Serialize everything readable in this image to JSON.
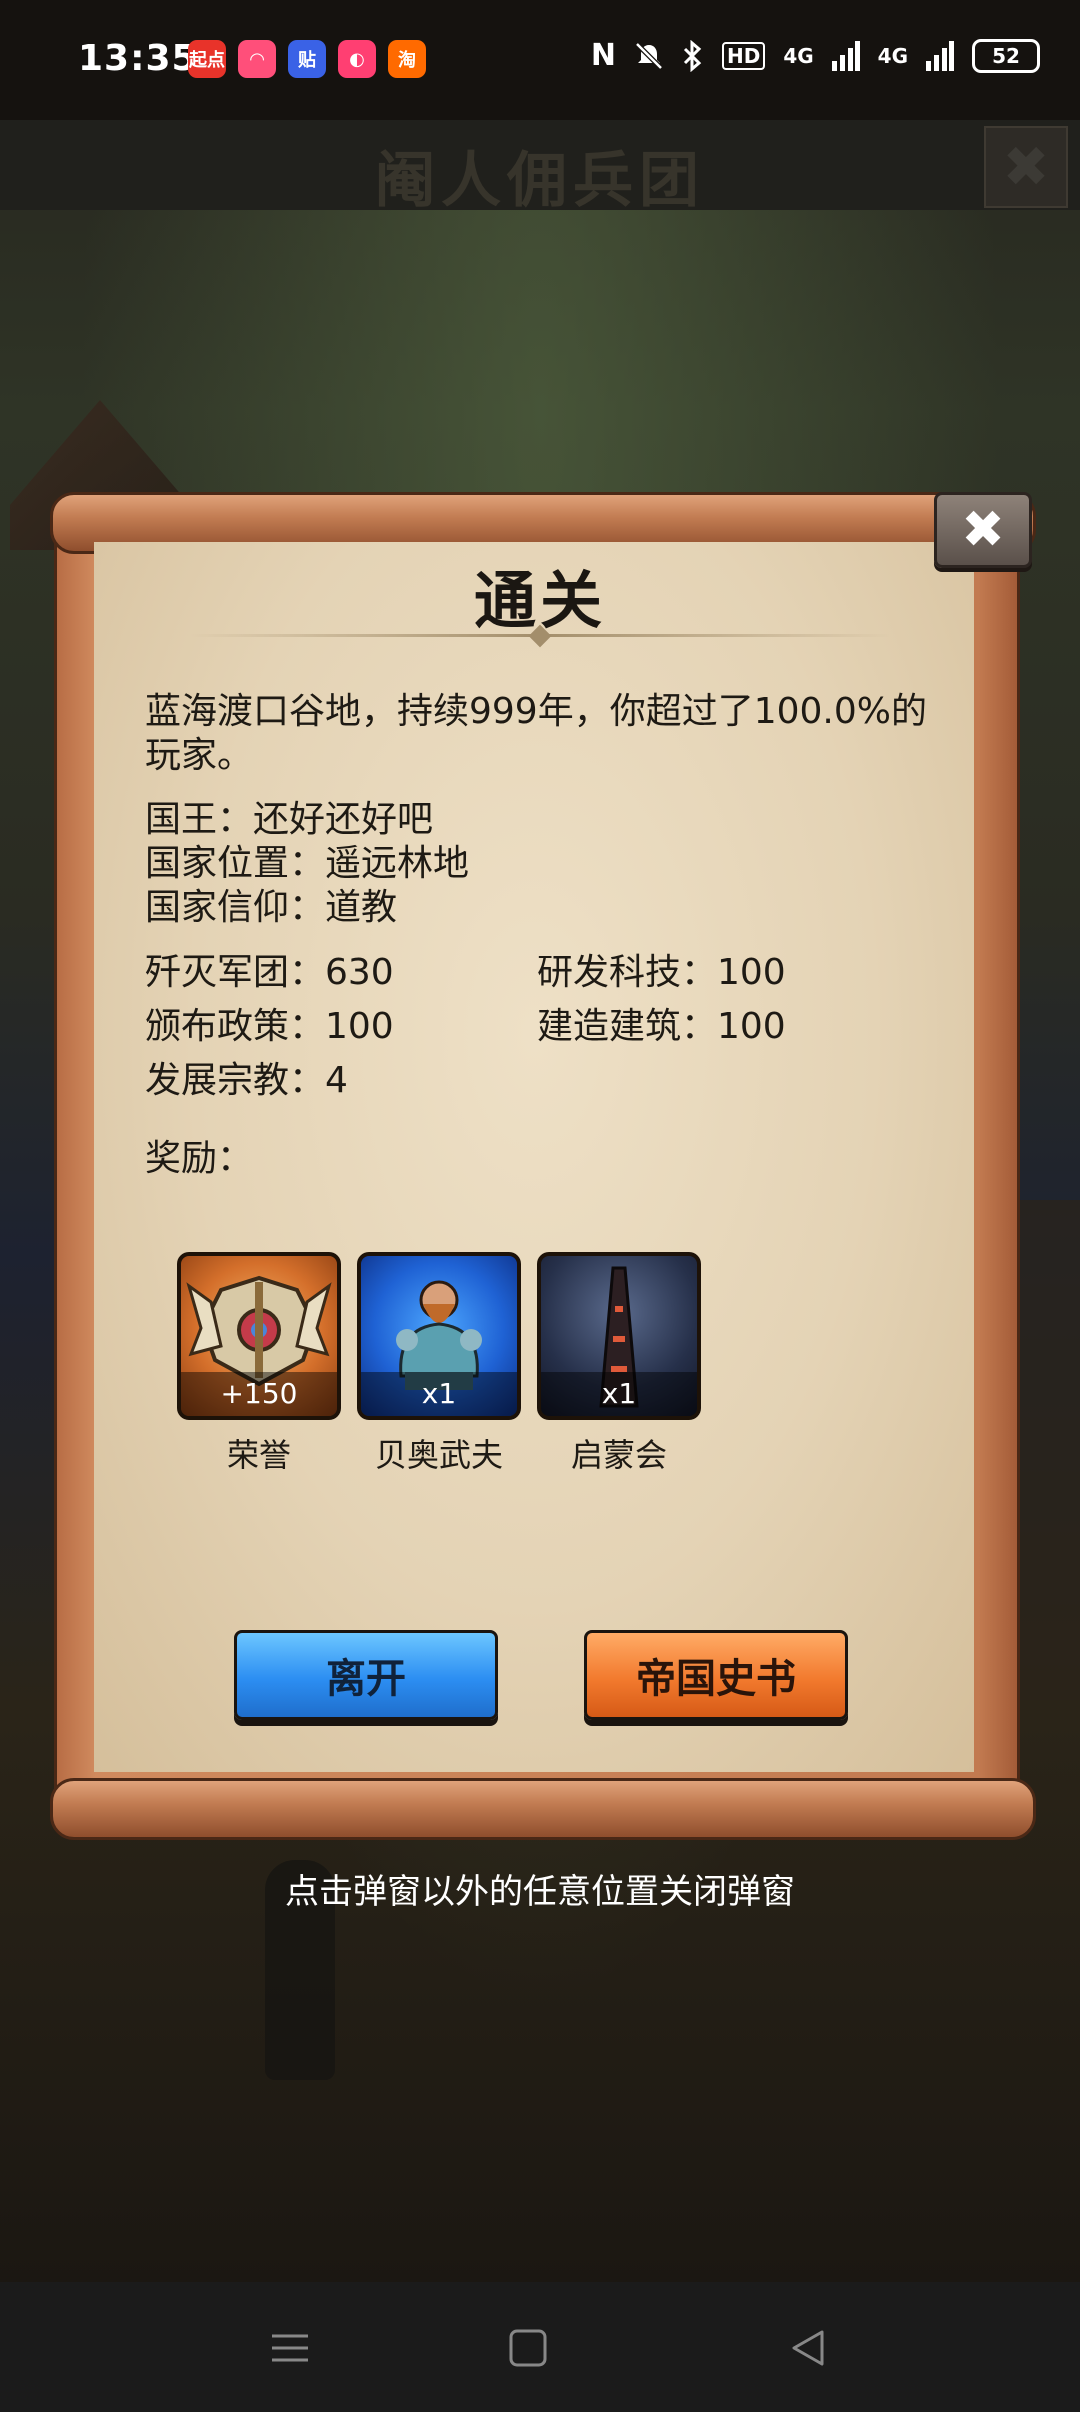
{
  "status_bar": {
    "time": "13:35",
    "app_icons": [
      {
        "name": "qidian-app-icon",
        "label": "起点",
        "color": "#e8332a"
      },
      {
        "name": "chat-app-icon",
        "label": "◠",
        "color": "#ff4f7a"
      },
      {
        "name": "tieba-app-icon",
        "label": "贴",
        "color": "#3a62e6"
      },
      {
        "name": "pink-app-icon",
        "label": "◐",
        "color": "#ff3f72"
      },
      {
        "name": "taobao-app-icon",
        "label": "淘",
        "color": "#ff6a00"
      }
    ],
    "nfc": "N",
    "hd": "HD",
    "signal1": "4G",
    "signal2": "4G",
    "battery": "52"
  },
  "game_header": {
    "title": "阉人佣兵团",
    "close": "✖"
  },
  "dialog": {
    "title": "通关",
    "close": "✖",
    "summary": "蓝海渡口谷地，持续999年，你超过了100.0%的玩家。",
    "info": [
      "国王：还好还好吧",
      "国家位置：遥远林地",
      "国家信仰：道教"
    ],
    "stats": [
      {
        "label": "歼灭军团：630"
      },
      {
        "label": "研发科技：100"
      },
      {
        "label": "颁布政策：100"
      },
      {
        "label": "建造建筑：100"
      },
      {
        "label": "发展宗教：4"
      }
    ],
    "rewards_label": "奖励：",
    "rewards": [
      {
        "name": "荣誉",
        "qty": "+150",
        "style": "orange",
        "icon": "honor-emblem-icon"
      },
      {
        "name": "贝奥武夫",
        "qty": "x1",
        "style": "blue",
        "icon": "beowulf-warrior-icon"
      },
      {
        "name": "启蒙会",
        "qty": "x1",
        "style": "blue",
        "icon": "enlightenment-tower-icon"
      }
    ],
    "buttons": {
      "leave": "离开",
      "history": "帝国史书"
    }
  },
  "hint": "点击弹窗以外的任意位置关闭弹窗",
  "nav_bar": {
    "menu_icon": "menu-icon",
    "home_icon": "home-icon",
    "back_icon": "back-icon"
  },
  "colors": {
    "leave_button": "#2c8ef2",
    "history_button": "#f27a2e",
    "parchment": "#e4d3b5",
    "frame": "#c27a50"
  }
}
